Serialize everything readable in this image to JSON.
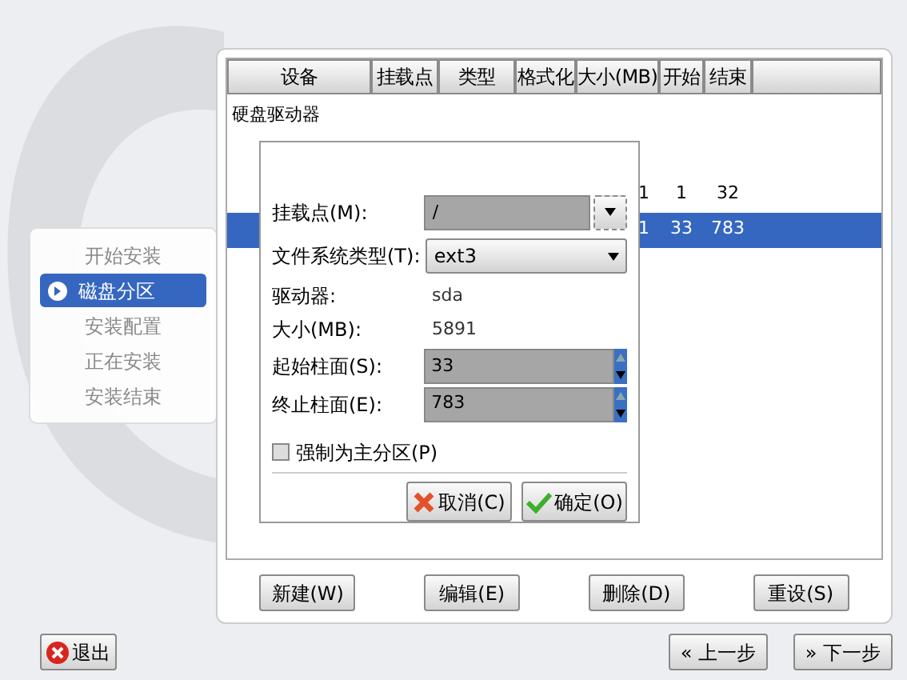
{
  "sidebar": {
    "items": [
      {
        "label": "开始安装",
        "selected": false
      },
      {
        "label": "磁盘分区",
        "selected": true
      },
      {
        "label": "安装配置",
        "selected": false
      },
      {
        "label": "正在安装",
        "selected": false
      },
      {
        "label": "安装结束",
        "selected": false
      }
    ]
  },
  "table": {
    "columns": [
      "设备",
      "挂载点",
      "类型",
      "格式化",
      "大小(MB)",
      "开始",
      "结束"
    ],
    "group": "硬盘驱动器",
    "rows": [
      {
        "size": "1",
        "start": "1",
        "end": "32",
        "selected": false
      },
      {
        "size": "1",
        "start": "33",
        "end": "783",
        "selected": true
      }
    ]
  },
  "dialog": {
    "fields": [
      {
        "kind": "combo",
        "label": "挂载点(M):",
        "value": "/"
      },
      {
        "kind": "select",
        "label": "文件系统类型(T):",
        "value": "ext3"
      },
      {
        "kind": "info",
        "label": "驱动器:",
        "value": "sda"
      },
      {
        "kind": "info",
        "label": "大小(MB):",
        "value": "5891"
      },
      {
        "kind": "spin",
        "label": "起始柱面(S):",
        "value": "33"
      },
      {
        "kind": "spin",
        "label": "终止柱面(E):",
        "value": "783"
      }
    ],
    "checkbox": {
      "label": "强制为主分区(P)",
      "checked": false
    },
    "cancel": "取消(C)",
    "ok": "确定(O)"
  },
  "actions": [
    "新建(W)",
    "编辑(E)",
    "删除(D)",
    "重设(S)"
  ],
  "quit": "退出",
  "back": "« 上一步",
  "next": "» 下一步"
}
